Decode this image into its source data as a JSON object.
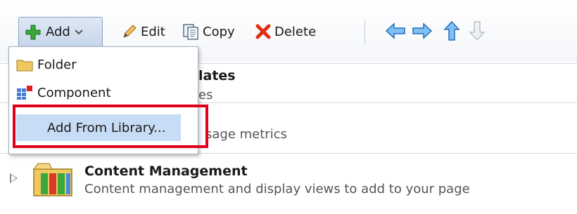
{
  "toolbar": {
    "add_label": "Add",
    "edit_label": "Edit",
    "copy_label": "Copy",
    "delete_label": "Delete",
    "nav_icons": [
      "arrow-left-icon",
      "arrow-right-icon",
      "arrow-up-icon",
      "arrow-down-icon"
    ]
  },
  "add_menu": {
    "items": [
      {
        "label": "Folder",
        "icon": "folder-icon"
      },
      {
        "label": "Component",
        "icon": "component-icon"
      },
      {
        "label": "Add From Library...",
        "icon": ""
      }
    ]
  },
  "list": {
    "rows": [
      {
        "title": "lates",
        "description": "es"
      },
      {
        "title": "",
        "description": "sage metrics"
      },
      {
        "title": "Content Management",
        "description": "Content management and display views to add to your page"
      }
    ]
  },
  "colors": {
    "accent": "#c6ddf5",
    "highlight_border": "#e0001a",
    "add_green": "#2f9a2f",
    "delete_red": "#e03010",
    "nav_blue": "#3a8fe0"
  }
}
